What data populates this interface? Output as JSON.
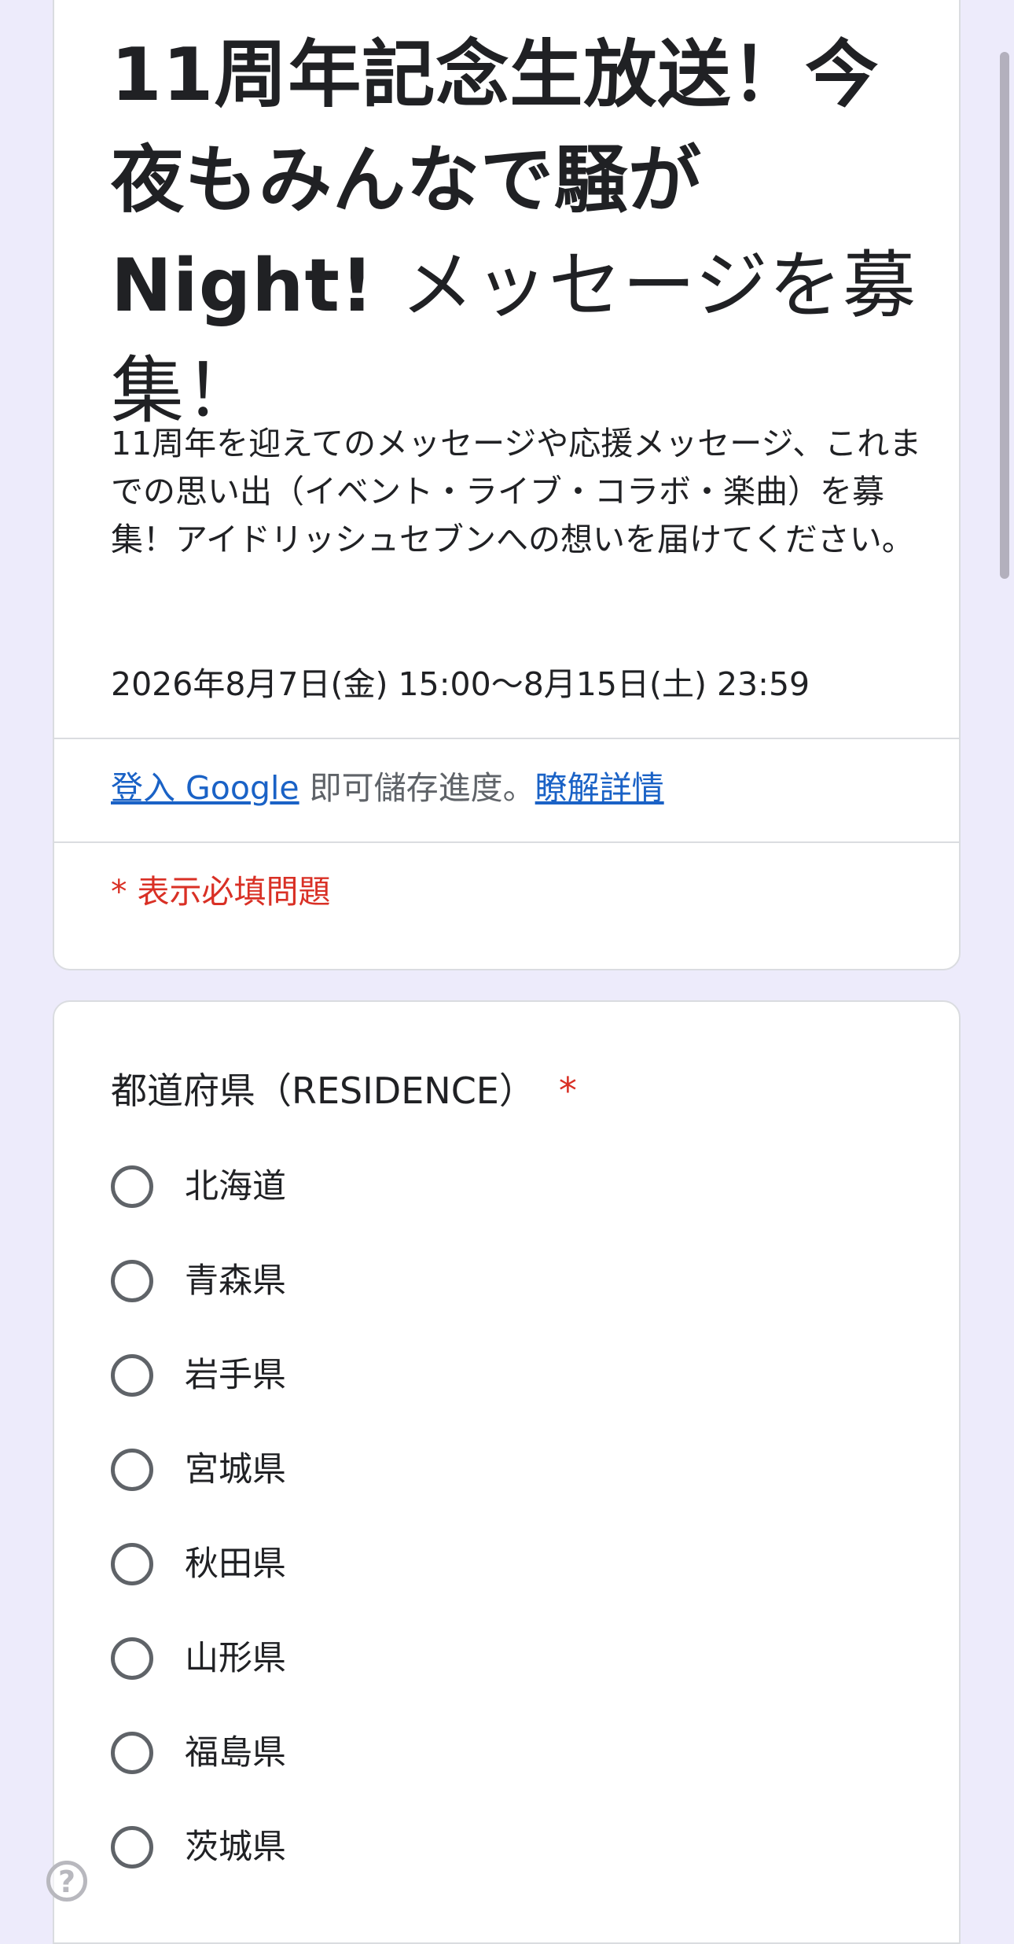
{
  "form": {
    "title_bold": "11周年記念生放送！今夜もみんなで騒がNight!",
    "title_rest": "メッセージを募集！",
    "description": "11周年を迎えてのメッセージや応援メッセージ、これまでの思い出（イベント・ライブ・コラボ・楽曲）を募集！アイドリッシュセブンへの想いを届けてください。",
    "period": "2026年8月7日(金) 15:00〜8月15日(土) 23:59",
    "signin_link": "登入 Google",
    "signin_text": " 即可儲存進度。",
    "learn_more_link": "瞭解詳情",
    "required_note": "* 表示必填問題"
  },
  "question": {
    "title": "都道府県（RESIDENCE）",
    "required_mark": "*",
    "options": [
      "北海道",
      "青森県",
      "岩手県",
      "宮城県",
      "秋田県",
      "山形県",
      "福島県",
      "茨城県"
    ]
  },
  "help": {
    "icon": "help-icon",
    "glyph": "?"
  }
}
